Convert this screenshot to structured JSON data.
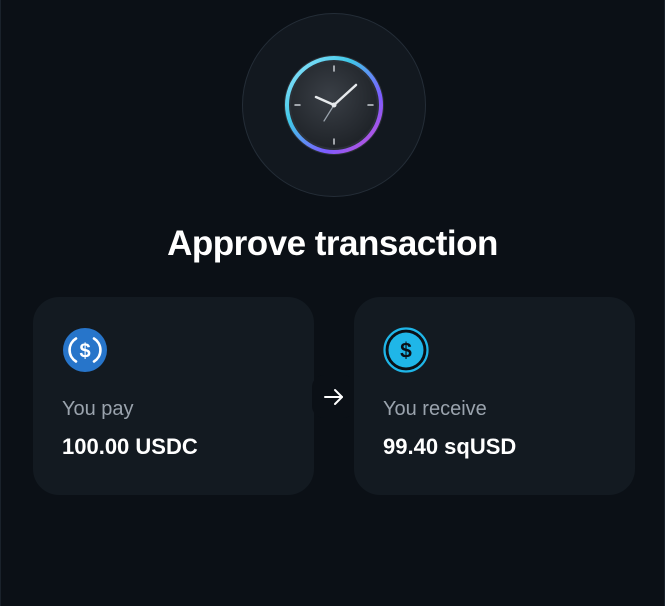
{
  "header": {
    "icon": "clock-icon"
  },
  "title": "Approve transaction",
  "pay": {
    "label": "You pay",
    "value": "100.00 USDC",
    "icon": "usdc-icon",
    "icon_color": "#2775ca"
  },
  "arrow": {
    "icon": "arrow-right-icon"
  },
  "receive": {
    "label": "You receive",
    "value": "99.40 sqUSD",
    "icon": "dollar-icon",
    "icon_color": "#1fb6e8"
  },
  "colors": {
    "background": "#0b1016",
    "card": "#131a21",
    "text_primary": "#ffffff",
    "text_secondary": "#9aa3ad"
  }
}
